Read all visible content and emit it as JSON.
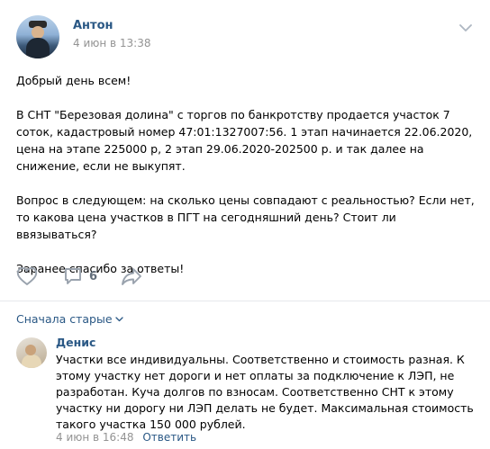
{
  "post": {
    "author": "Антон",
    "date": "4 июн в 13:38",
    "paragraphs": [
      "Добрый день всем!",
      "В СНТ \"Березовая долина\" с торгов по банкротству продается участок 7 соток, кадастровый номер 47:01:1327007:56. 1 этап начинается 22.06.2020, цена на этапе 225000 р, 2 этап 29.06.2020-202500 р. и так далее на снижение, если не выкупят.",
      "Вопрос в следующем: на сколько цены совпадают с реальностью? Если нет, то какова цена участков в ПГТ на сегодняшний день? Стоит ли ввязываться?",
      "Заранее спасибо за ответы!"
    ],
    "comment_count": "6"
  },
  "icons": {
    "like": "heart-icon",
    "comment": "comment-icon",
    "share": "share-icon",
    "more": "chevron-down-icon"
  },
  "colors": {
    "link": "#2a5885",
    "muted": "#939393",
    "icon": "#99a2ad"
  },
  "comments": {
    "sort_label": "Сначала старые",
    "items": [
      {
        "author": "Денис",
        "text": "Участки все индивидуальны. Соответственно и стоимость разная. К этому участку нет дороги и нет оплаты за подключение к ЛЭП, не разработан. Куча долгов по взносам. Соответственно СНТ к этому участку ни дорогу ни ЛЭП делать не будет. Максимальная стоимость такого участка 150 000 рублей.",
        "date": "4 июн в 16:48",
        "reply_label": "Ответить"
      }
    ]
  }
}
